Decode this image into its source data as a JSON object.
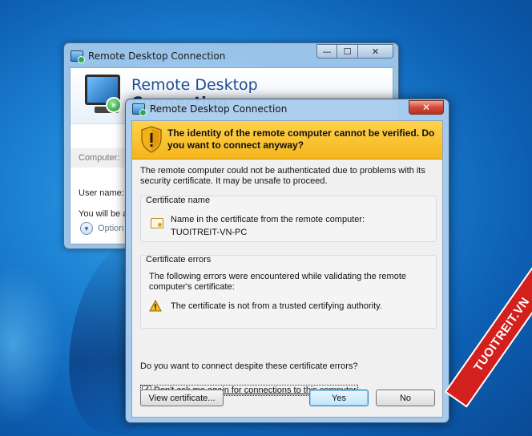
{
  "back_window": {
    "title": "Remote Desktop Connection",
    "heading_line1": "Remote Desktop",
    "heading_line2": "Connection",
    "computer_label": "Computer:",
    "username_label": "User name:",
    "info_text": "You will be a",
    "options_label": "Option",
    "caption": {
      "minimize": "—",
      "maximize": "☐",
      "close": "✕"
    }
  },
  "dialog": {
    "title": "Remote Desktop Connection",
    "close_glyph": "✕",
    "warning": "The identity of the remote computer cannot be verified. Do you want to connect anyway?",
    "intro": "The remote computer could not be authenticated due to problems with its security certificate. It may be unsafe to proceed.",
    "cert_name_group": {
      "title": "Certificate name",
      "line1": "Name in the certificate from the remote computer:",
      "line2": "TUOITREIT-VN-PC"
    },
    "cert_errors_group": {
      "title": "Certificate errors",
      "description": "The following errors were encountered while validating the remote computer's certificate:",
      "error": "The certificate is not from a trusted certifying authority."
    },
    "question": "Do you want to connect despite these certificate errors?",
    "checkbox": {
      "label": "Don't ask me again for connections to this computer",
      "checked": true,
      "glyph": "✓"
    },
    "buttons": {
      "view_certificate": "View certificate...",
      "yes": "Yes",
      "no": "No"
    }
  },
  "watermark": "TUOITREIT.VN",
  "icons": [
    "app-icon",
    "shield-warning-icon",
    "certificate-icon",
    "warning-triangle-icon",
    "options-chevron-icon"
  ],
  "colors": {
    "warning_banner": "#f7bd24",
    "desktop": "#1f86d6",
    "watermark": "#d4201c"
  }
}
